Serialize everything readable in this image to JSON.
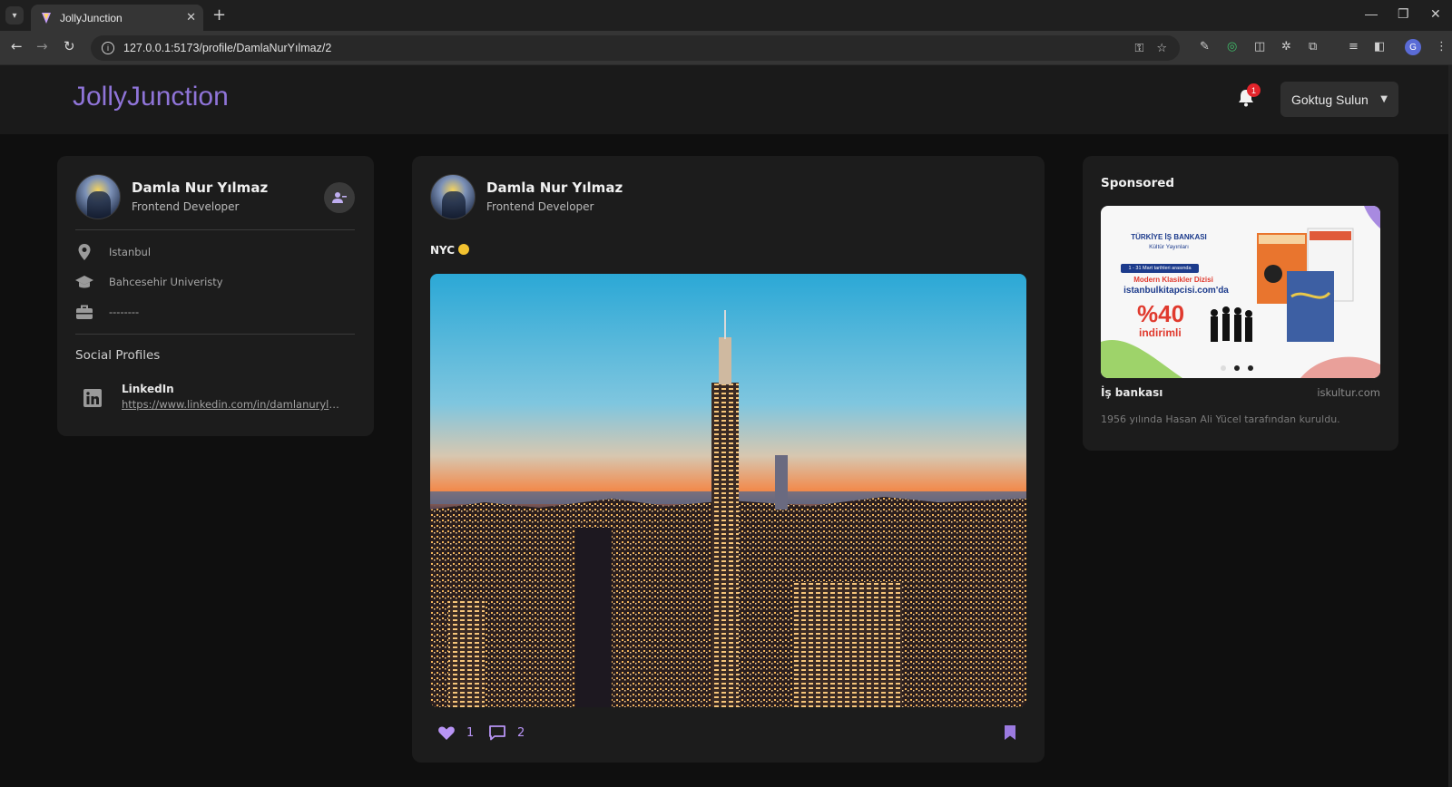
{
  "browser": {
    "tab_title": "JollyJunction",
    "url": "127.0.0.1:5173/profile/DamlaNurYılmaz/2",
    "profile_initial": "G"
  },
  "app": {
    "logo": "JollyJunction",
    "notification_count": "1",
    "current_user": "Goktug Sulun",
    "accent_color": "#8f74d8"
  },
  "profile": {
    "name": "Damla Nur Yılmaz",
    "role": "Frontend Developer",
    "location": "Istanbul",
    "school": "Bahcesehir Univeristy",
    "work": "--------",
    "social_title": "Social Profiles",
    "social": {
      "network": "LinkedIn",
      "link": "https://www.linkedin.com/in/damlanurylmaz"
    }
  },
  "post": {
    "author": "Damla Nur Yılmaz",
    "author_role": "Frontend Developer",
    "text": "NYC",
    "likes": "1",
    "comments": "2"
  },
  "sponsored": {
    "title": "Sponsored",
    "name": "İş bankası",
    "domain": "iskultur.com",
    "description": "1956 yılında Hasan Ali Yücel tarafından kuruldu.",
    "banner": {
      "brand": "TÜRKİYE İŞ BANKASI",
      "sub": "Kültür Yayınları",
      "date": "1 - 31 Mart tarihleri arasında",
      "series": "Modern Klasikler Dizisi",
      "site": "istanbulkitapcisi.com'da",
      "percent": "%40",
      "discount": "indirimli"
    }
  }
}
